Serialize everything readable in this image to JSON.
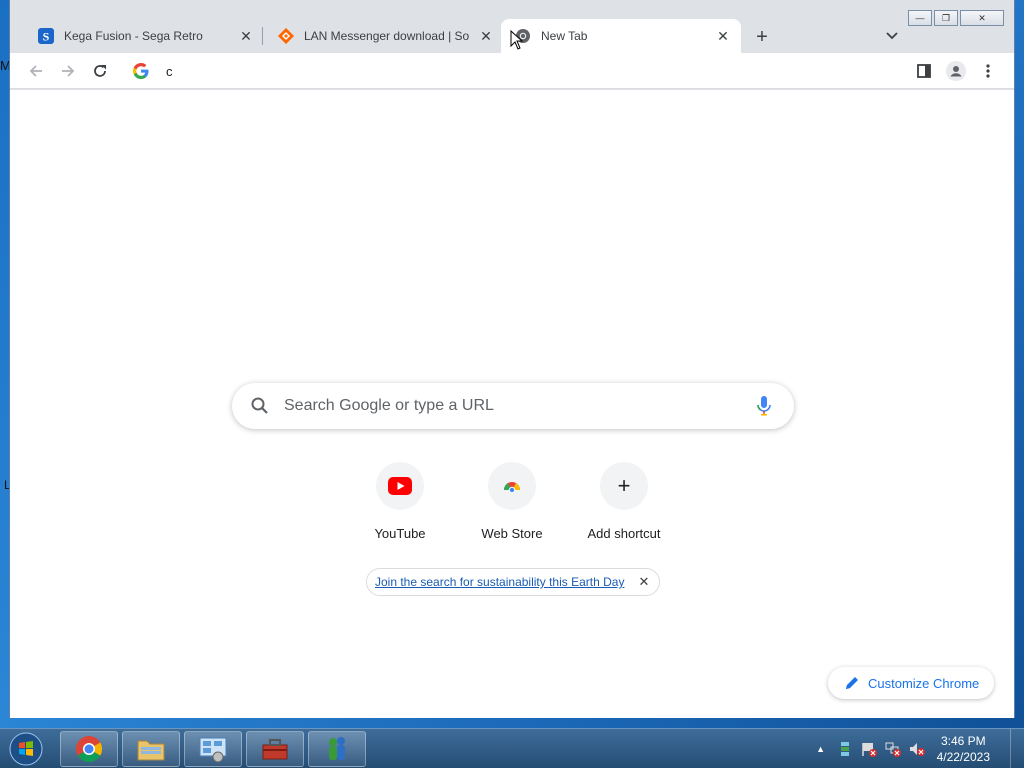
{
  "desktop": {
    "edge_label": "M",
    "edge_label2": "L"
  },
  "tabs": [
    {
      "title": "Kega Fusion - Sega Retro",
      "close": "✕"
    },
    {
      "title": "LAN Messenger download | SourceForge.net",
      "close": "✕"
    },
    {
      "title": "New Tab",
      "close": "✕"
    }
  ],
  "tabstrip": {
    "new_tab": "+"
  },
  "window_controls": {
    "minimize": "—",
    "maximize": "❐",
    "close": "✕"
  },
  "omnibox": {
    "value": "c"
  },
  "ntp": {
    "search_placeholder": "Search Google or type a URL",
    "shortcuts": [
      {
        "label": "YouTube"
      },
      {
        "label": "Web Store"
      },
      {
        "label": "Add shortcut"
      }
    ],
    "add_symbol": "+",
    "promo_text": "Join the search for sustainability this Earth Day",
    "promo_close": "✕",
    "customize_label": "Customize Chrome"
  },
  "taskbar": {
    "time": "3:46 PM",
    "date": "4/22/2023",
    "tray_arrow": "▲"
  },
  "colors": {
    "accent": "#1a73e8",
    "youtube_red": "#ff0000",
    "tab_strip": "#dee1e6"
  }
}
